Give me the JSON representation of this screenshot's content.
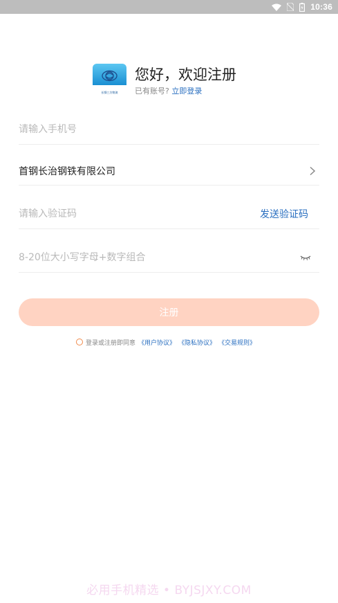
{
  "status_bar": {
    "time": "10:36",
    "icons": [
      "wifi-icon",
      "no-sim-icon",
      "battery-icon"
    ]
  },
  "header": {
    "welcome": "您好，欢迎注册",
    "has_account": "已有账号?",
    "login_link": "立即登录",
    "logo_text": "长钢三方物流"
  },
  "form": {
    "phone_placeholder": "请输入手机号",
    "company": "首钢长治钢铁有限公司",
    "code_placeholder": "请输入验证码",
    "send_code": "发送验证码",
    "password_placeholder": "8-20位大小写字母+数字组合"
  },
  "register_button": "注册",
  "agreement": {
    "prefix": "登录或注册即同意",
    "user_agreement": "《用户协议》",
    "privacy_agreement": "《隐私协议》",
    "trade_rules": "《交易规则》"
  },
  "watermark": "必用手机精选 • BYJSJXY.COM",
  "colors": {
    "accent_blue": "#2a6fc0",
    "button_bg": "#ffd3c2",
    "status_bar": "#bdbdbd",
    "radio_border": "#f08a4b"
  }
}
